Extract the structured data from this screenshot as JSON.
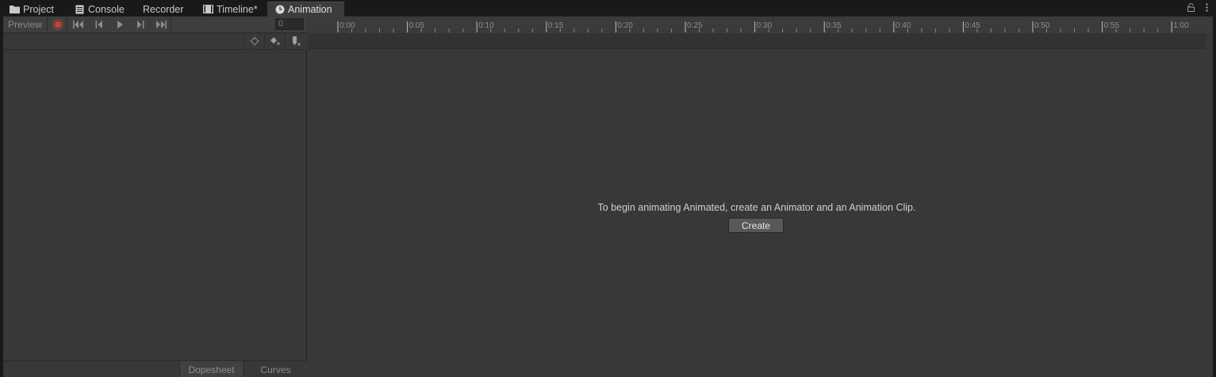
{
  "tabs": [
    {
      "label": "Project",
      "icon": "folder-icon"
    },
    {
      "label": "Console",
      "icon": "console-icon"
    },
    {
      "label": "Recorder",
      "icon": ""
    },
    {
      "label": "Timeline*",
      "icon": "film-icon"
    },
    {
      "label": "Animation",
      "icon": "clock-icon",
      "active": true
    }
  ],
  "window": {
    "lock_icon": "lock-icon",
    "menu_icon": "kebab-menu-icon"
  },
  "controls": {
    "preview_label": "Preview",
    "frame_value": "0"
  },
  "ruler": {
    "ticks": [
      "0:00",
      "0:05",
      "0:10",
      "0:15",
      "0:20",
      "0:25",
      "0:30",
      "0:35",
      "0:40",
      "0:45",
      "0:50",
      "0:55",
      "1:00"
    ]
  },
  "main": {
    "message": "To begin animating Animated, create an Animator and an Animation Clip.",
    "create_label": "Create"
  },
  "bottom_tabs": {
    "dopesheet_label": "Dopesheet",
    "curves_label": "Curves"
  },
  "colors": {
    "record": "#c0483c",
    "background": "#383838",
    "tabbar": "#191919"
  }
}
